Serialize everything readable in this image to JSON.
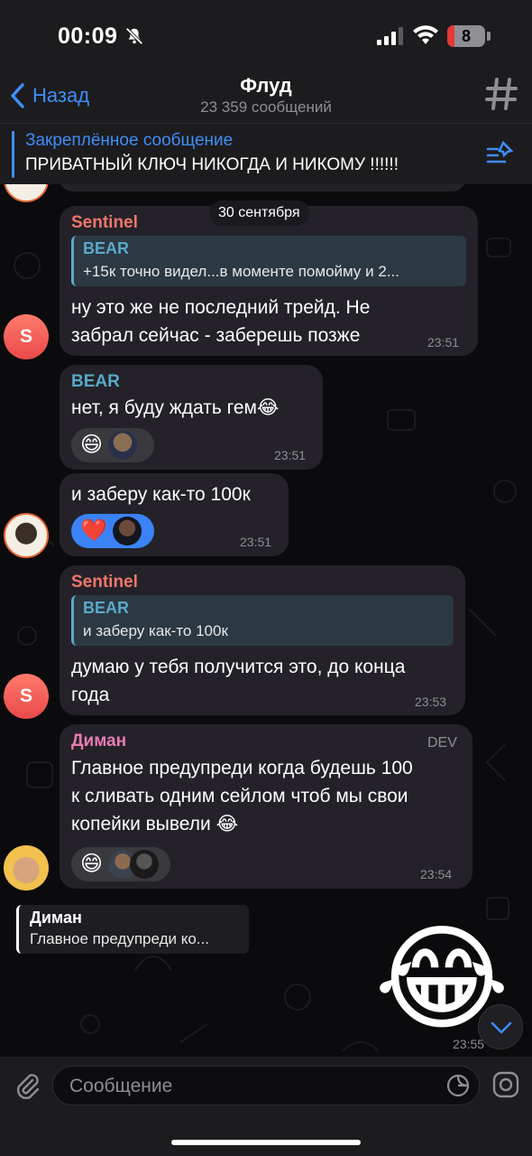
{
  "status_bar": {
    "time": "00:09",
    "battery": "8"
  },
  "header": {
    "back_label": "Назад",
    "title": "Флуд",
    "subtitle": "23 359 сообщений"
  },
  "pinned": {
    "title": "Закреплённое сообщение",
    "text": "ПРИВАТНЫЙ КЛЮЧ НИКОГДА И НИКОМУ !!!!!!"
  },
  "date_separator": "30 сентября",
  "messages": [
    {
      "sender": "Sentinel",
      "quote_author": "BEAR",
      "quote_text": "+15к точно видел...в моменте помойму и 2...",
      "lines": [
        "ну это же не последний трейд. Не",
        "забрал сейчас - заберешь позже"
      ],
      "time": "23:51",
      "avatar_letter": "S"
    },
    {
      "sender": "BEAR",
      "lines": [
        "нет, я буду ждать гем😂"
      ],
      "reaction_emoji": "😄",
      "time": "23:51"
    },
    {
      "lines": [
        "и заберу как-то 100к"
      ],
      "reaction_emoji": "❤️",
      "time": "23:51"
    },
    {
      "sender": "Sentinel",
      "quote_author": "BEAR",
      "quote_text": "и заберу как-то 100к",
      "lines": [
        "думаю у тебя получится это, до конца",
        "года"
      ],
      "time": "23:53",
      "avatar_letter": "S"
    },
    {
      "sender": "Диман",
      "badge": "DEV",
      "lines": [
        "Главное предупреди когда будешь 100",
        "к сливать одним сейлом чтоб мы свои",
        "копейки вывели 😂"
      ],
      "reaction_emoji": "😄",
      "time": "23:54"
    }
  ],
  "reply_preview": {
    "author": "Диман",
    "text": "Главное предупреди ко..."
  },
  "sticker": {
    "emoji": "😂",
    "time": "23:55"
  },
  "input": {
    "placeholder": "Сообщение"
  },
  "colors": {
    "accent": "#3e8ef7",
    "sentinel": "#f0766a",
    "bear": "#5aa9cc",
    "diman": "#e97bb4",
    "bubble": "#242228"
  }
}
